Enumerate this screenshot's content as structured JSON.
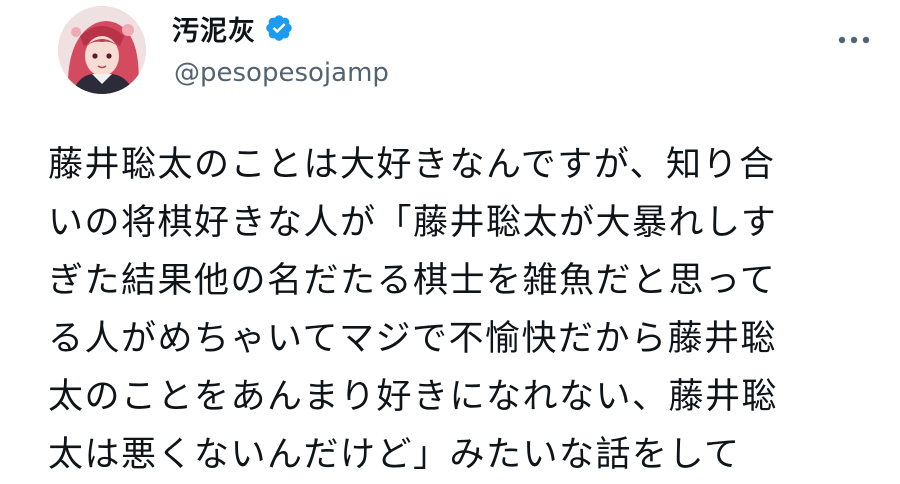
{
  "tweet": {
    "display_name": "汚泥灰",
    "handle": "@pesopesojamp",
    "lines": [
      "藤井聡太のことは大好きなんですが、知り合",
      "いの将棋好きな人が「藤井聡太が大暴れしす",
      "ぎた結果他の名だたる棋士を雑魚だと思って",
      "る人がめちゃいてマジで不愉快だから藤井聡",
      "太のことをあんまり好きになれない、藤井聡",
      "太は悪くないんだけど」みたいな話をして"
    ]
  },
  "icons": {
    "verified": "verified-badge-icon",
    "more": "more-options-icon"
  },
  "colors": {
    "text_primary": "#0f1419",
    "text_secondary": "#536471",
    "verified_blue": "#1d9bf0"
  }
}
